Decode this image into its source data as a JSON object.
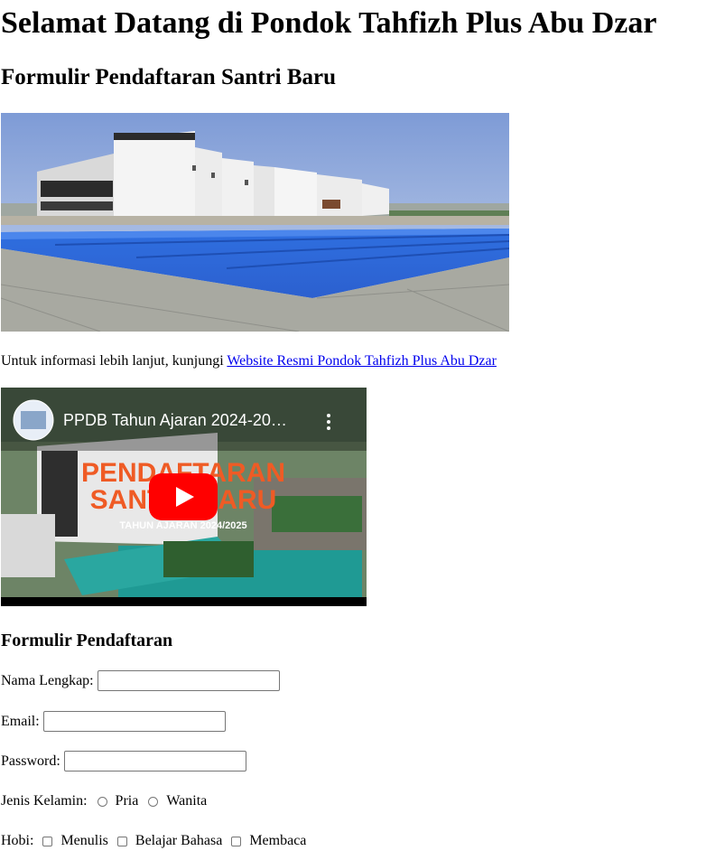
{
  "page": {
    "heading": "Selamat Datang di Pondok Tahfizh Plus Abu Dzar",
    "subheading": "Formulir Pendaftaran Santri Baru"
  },
  "info": {
    "text": "Untuk informasi lebih lanjut, kunjungi",
    "link_text": "Website Resmi Pondok Tahfizh Plus Abu Dzar"
  },
  "video": {
    "title": "PPDB Tahun Ajaran 2024-20…",
    "thumbnail_line1": "PENDAFTARAN",
    "thumbnail_line2": "SANTRI BARU",
    "thumbnail_line3": "TAHUN AJARAN 2024/2025"
  },
  "form": {
    "title": "Formulir Pendaftaran",
    "name_label": "Nama Lengkap:",
    "name_value": "",
    "email_label": "Email:",
    "email_value": "",
    "password_label": "Password:",
    "password_value": "",
    "gender_label": "Jenis Kelamin:",
    "gender_options": [
      "Pria",
      "Wanita"
    ],
    "hobby_label": "Hobi:",
    "hobby_options": [
      "Menulis",
      "Belajar Bahasa",
      "Membaca"
    ]
  }
}
